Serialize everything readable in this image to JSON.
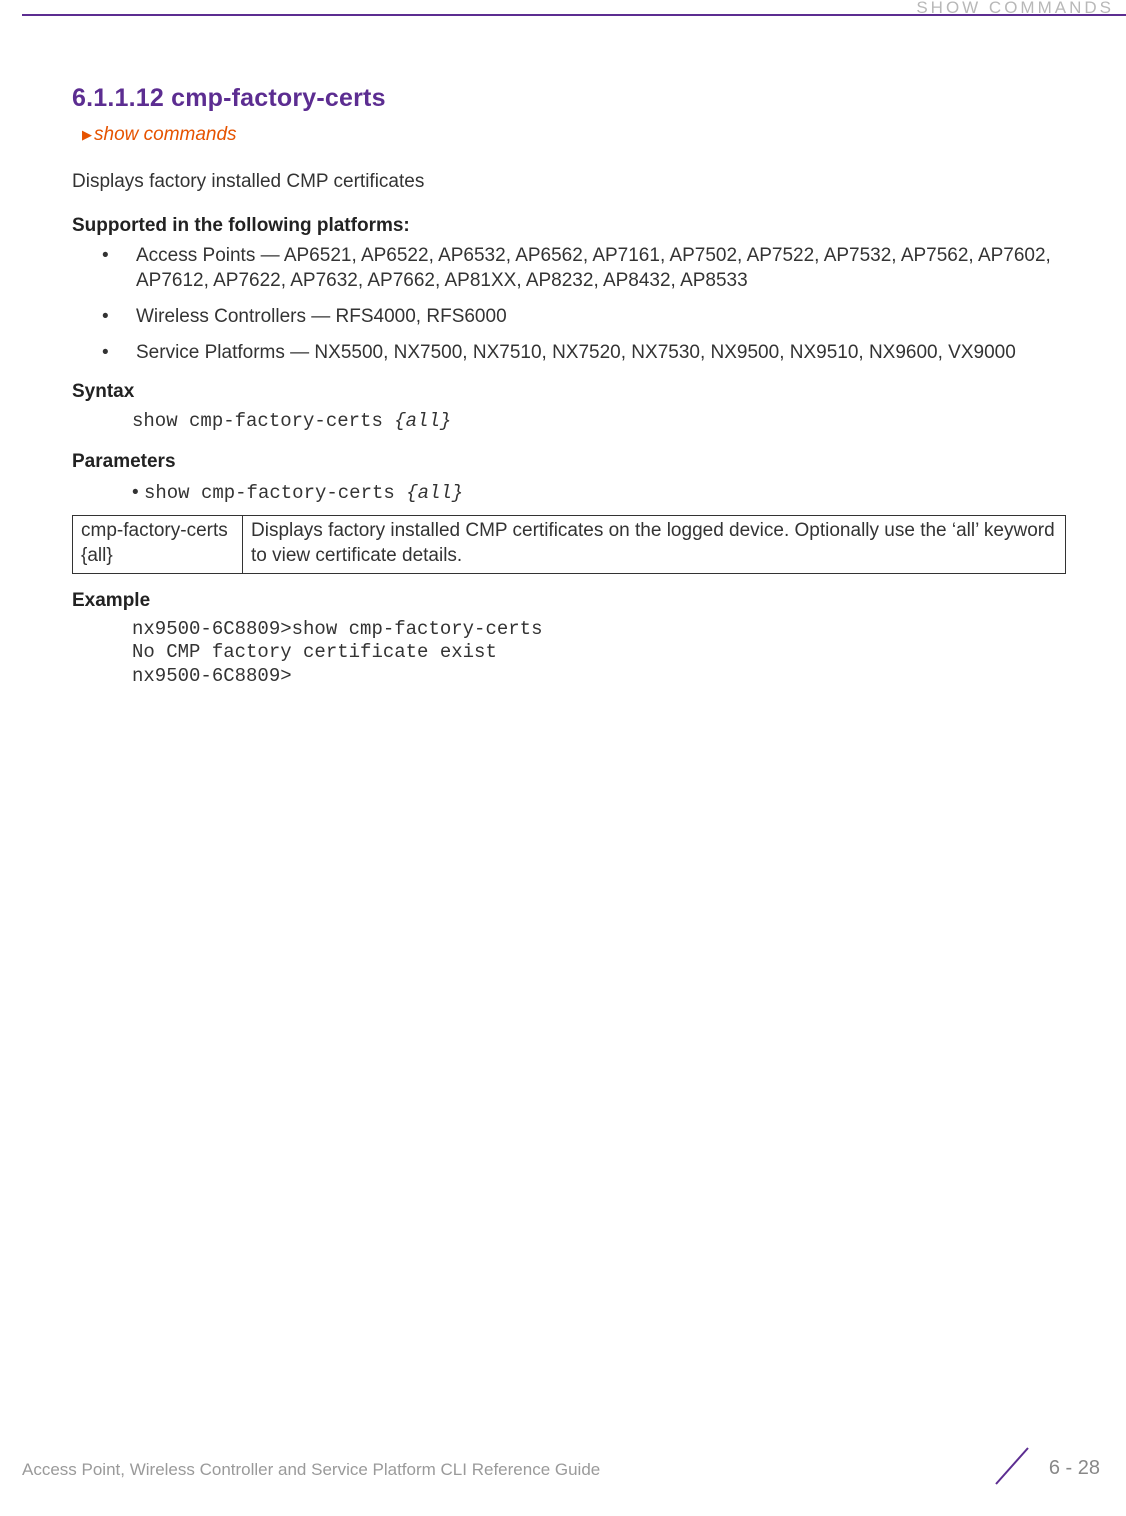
{
  "header": {
    "category": "SHOW COMMANDS"
  },
  "section": {
    "number_title": "6.1.1.12 cmp-factory-certs",
    "breadcrumb": "show commands",
    "intro": "Displays factory installed CMP certificates"
  },
  "platforms": {
    "heading": "Supported in the following platforms:",
    "items": [
      "Access Points — AP6521, AP6522, AP6532, AP6562, AP7161, AP7502, AP7522, AP7532, AP7562, AP7602, AP7612, AP7622, AP7632, AP7662, AP81XX, AP8232, AP8432, AP8533",
      "Wireless Controllers — RFS4000, RFS6000",
      "Service Platforms — NX5500, NX7500, NX7510, NX7520, NX7530, NX9500, NX9510, NX9600, VX9000"
    ]
  },
  "syntax": {
    "heading": "Syntax",
    "cmd_fixed": "show cmp-factory-certs ",
    "cmd_ital": "{all}"
  },
  "parameters": {
    "heading": "Parameters",
    "bullet_fixed": "show cmp-factory-certs ",
    "bullet_ital": "{all}",
    "table": {
      "c1a": "cmp-factory-certs",
      "c1b": "{all}",
      "c2": "Displays factory installed CMP certificates on the logged device. Optionally use the ‘all’ keyword to view certificate details."
    }
  },
  "example": {
    "heading": "Example",
    "text": "nx9500-6C8809>show cmp-factory-certs\nNo CMP factory certificate exist\nnx9500-6C8809>"
  },
  "footer": {
    "guide": "Access Point, Wireless Controller and Service Platform CLI Reference Guide",
    "page": "6 - 28"
  }
}
